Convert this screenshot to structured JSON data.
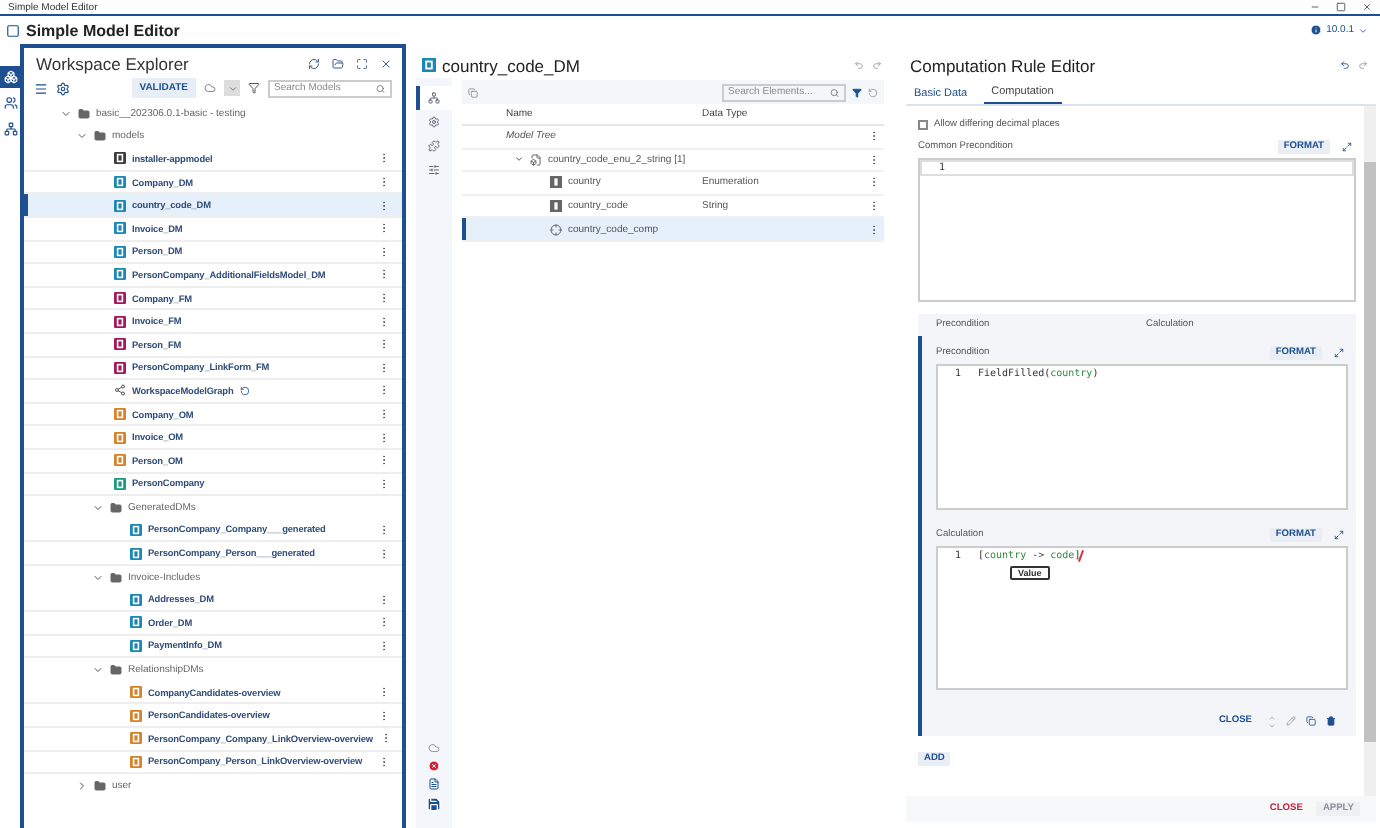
{
  "os_window": {
    "title": "Simple Model Editor"
  },
  "app": {
    "title": "Simple Model Editor",
    "version": "10.0.1"
  },
  "left_rail": [
    {
      "kind": "models",
      "selected": true
    },
    {
      "kind": "users",
      "selected": false
    },
    {
      "kind": "sync",
      "selected": false
    }
  ],
  "explorer": {
    "title": "Workspace Explorer",
    "validate": "VALIDATE",
    "search_placeholder": "Search Models",
    "tree": [
      {
        "label": "basic__202306.0.1-basic - testing",
        "kind": "folder",
        "expanded": true,
        "children": [
          {
            "label": "models",
            "kind": "folder",
            "expanded": true,
            "children": [
              {
                "label": "installer-appmodel",
                "kind": "app",
                "selected": false
              },
              {
                "label": "Company_DM",
                "kind": "dm",
                "selected": false
              },
              {
                "label": "country_code_DM",
                "kind": "dm",
                "selected": true
              },
              {
                "label": "Invoice_DM",
                "kind": "dm",
                "selected": false
              },
              {
                "label": "Person_DM",
                "kind": "dm",
                "selected": false
              },
              {
                "label": "PersonCompany_AdditionalFieldsModel_DM",
                "kind": "dm",
                "selected": false
              },
              {
                "label": "Company_FM",
                "kind": "fm",
                "selected": false
              },
              {
                "label": "Invoice_FM",
                "kind": "fm",
                "selected": false
              },
              {
                "label": "Person_FM",
                "kind": "fm",
                "selected": false
              },
              {
                "label": "PersonCompany_LinkForm_FM",
                "kind": "fm",
                "selected": false
              },
              {
                "label": "WorkspaceModelGraph",
                "kind": "graph",
                "selected": false
              },
              {
                "label": "Company_OM",
                "kind": "om",
                "selected": false
              },
              {
                "label": "Invoice_OM",
                "kind": "om",
                "selected": false
              },
              {
                "label": "Person_OM",
                "kind": "om",
                "selected": false
              },
              {
                "label": "PersonCompany",
                "kind": "bo",
                "selected": false
              },
              {
                "label": "GeneratedDMs",
                "kind": "folder",
                "expanded": true,
                "children": [
                  {
                    "label": "PersonCompany_Company___generated",
                    "kind": "dm",
                    "selected": false
                  },
                  {
                    "label": "PersonCompany_Person___generated",
                    "kind": "dm",
                    "selected": false
                  }
                ]
              },
              {
                "label": "Invoice-Includes",
                "kind": "folder",
                "expanded": true,
                "children": [
                  {
                    "label": "Addresses_DM",
                    "kind": "dm",
                    "selected": false
                  },
                  {
                    "label": "Order_DM",
                    "kind": "dm",
                    "selected": false
                  },
                  {
                    "label": "PaymentInfo_DM",
                    "kind": "dm",
                    "selected": false
                  }
                ]
              },
              {
                "label": "RelationshipDMs",
                "kind": "folder",
                "expanded": true,
                "children": [
                  {
                    "label": "CompanyCandidates-overview",
                    "kind": "om",
                    "selected": false
                  },
                  {
                    "label": "PersonCandidates-overview",
                    "kind": "om",
                    "selected": false
                  },
                  {
                    "label": "PersonCompany_Company_LinkOverview-overview",
                    "kind": "om",
                    "selected": false
                  },
                  {
                    "label": "PersonCompany_Person_LinkOverview-overview",
                    "kind": "om",
                    "selected": false
                  }
                ]
              }
            ]
          },
          {
            "label": "user",
            "kind": "folder",
            "expanded": false
          }
        ]
      }
    ]
  },
  "model_editor": {
    "title": "country_code_DM",
    "side_tabs": [
      {
        "kind": "tree",
        "selected": true
      },
      {
        "kind": "settings",
        "selected": false
      },
      {
        "kind": "plugins",
        "selected": false
      },
      {
        "kind": "options",
        "selected": false
      }
    ],
    "search_placeholder": "Search Elements...",
    "columns": [
      "Name",
      "Data Type"
    ],
    "rows": [
      {
        "name": "Model Tree",
        "kind": "root",
        "selected": false,
        "children": [
          {
            "name": "country_code_enu_2_string [1]",
            "kind": "group",
            "expanded": true,
            "selected": false,
            "children": [
              {
                "name": "country",
                "kind": "attribute",
                "data_type": "Enumeration",
                "selected": false
              },
              {
                "name": "country_code",
                "kind": "attribute",
                "data_type": "String",
                "selected": false
              },
              {
                "name": "country_code_comp",
                "kind": "computation",
                "selected": true
              }
            ]
          }
        ]
      }
    ]
  },
  "rule_editor": {
    "title": "Computation Rule Editor",
    "tabs": [
      {
        "label": "Basic Data",
        "selected": false
      },
      {
        "label": "Computation",
        "selected": true
      }
    ],
    "allow_decimal": {
      "label": "Allow differing decimal places",
      "checked": false
    },
    "common_precondition": {
      "label": "Common Precondition",
      "format": "FORMAT",
      "lines": [
        {
          "number": "1"
        }
      ]
    },
    "rule": {
      "headers": [
        "Precondition",
        "Calculation"
      ],
      "precondition": {
        "label": "Precondition",
        "format": "FORMAT",
        "lines": [
          {
            "number": "1",
            "tokens": [
              {
                "text": "FieldFilled(",
                "kind": "plain"
              },
              {
                "text": "country",
                "kind": "ident"
              },
              {
                "text": ")",
                "kind": "plain"
              }
            ]
          }
        ]
      },
      "calculation": {
        "label": "Calculation",
        "format": "FORMAT",
        "tooltip": "Value",
        "lines": [
          {
            "number": "1",
            "tokens": [
              {
                "text": "[",
                "kind": "plain"
              },
              {
                "text": "country",
                "kind": "ident"
              },
              {
                "text": " -> ",
                "kind": "plain"
              },
              {
                "text": "code",
                "kind": "ident"
              },
              {
                "text": "]",
                "kind": "plain"
              }
            ]
          }
        ]
      },
      "close": "CLOSE"
    },
    "add": "ADD",
    "close": "CLOSE",
    "apply": {
      "label": "APPLY",
      "disabled": true
    }
  }
}
